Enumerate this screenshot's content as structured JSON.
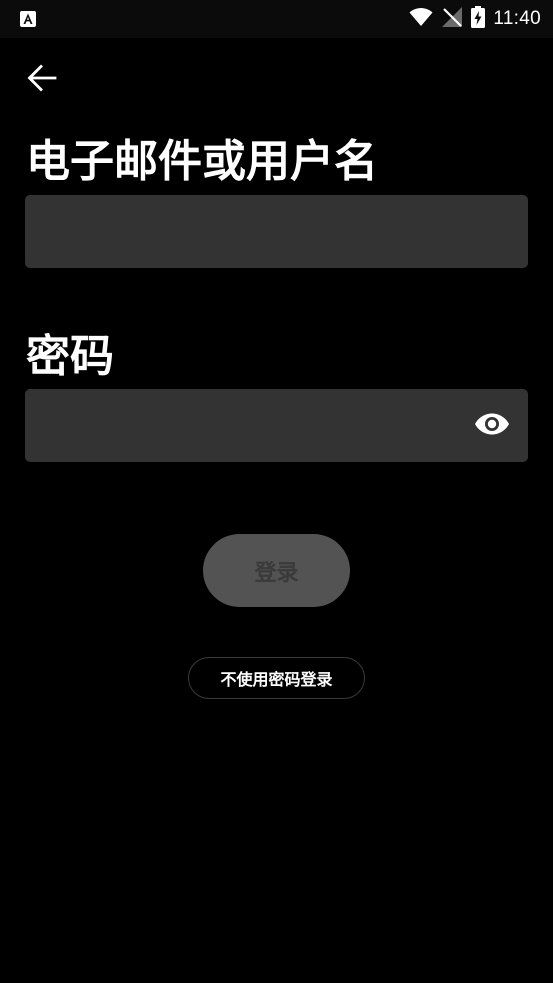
{
  "status_bar": {
    "time": "11:40",
    "icons": [
      "app-notification-icon",
      "wifi-icon",
      "no-signal-icon",
      "battery-charging-icon"
    ]
  },
  "header": {
    "back_icon": "arrow-left-icon"
  },
  "form": {
    "email_label": "电子邮件或用户名",
    "email_value": "",
    "password_label": "密码",
    "password_value": "",
    "password_toggle_icon": "eye-icon"
  },
  "actions": {
    "login_label": "登录",
    "passwordless_label": "不使用密码登录"
  },
  "colors": {
    "background": "#000000",
    "field_background": "#333333",
    "login_button_disabled": "#535353",
    "login_text_disabled": "#3a3a3a",
    "text_primary": "#ffffff"
  }
}
